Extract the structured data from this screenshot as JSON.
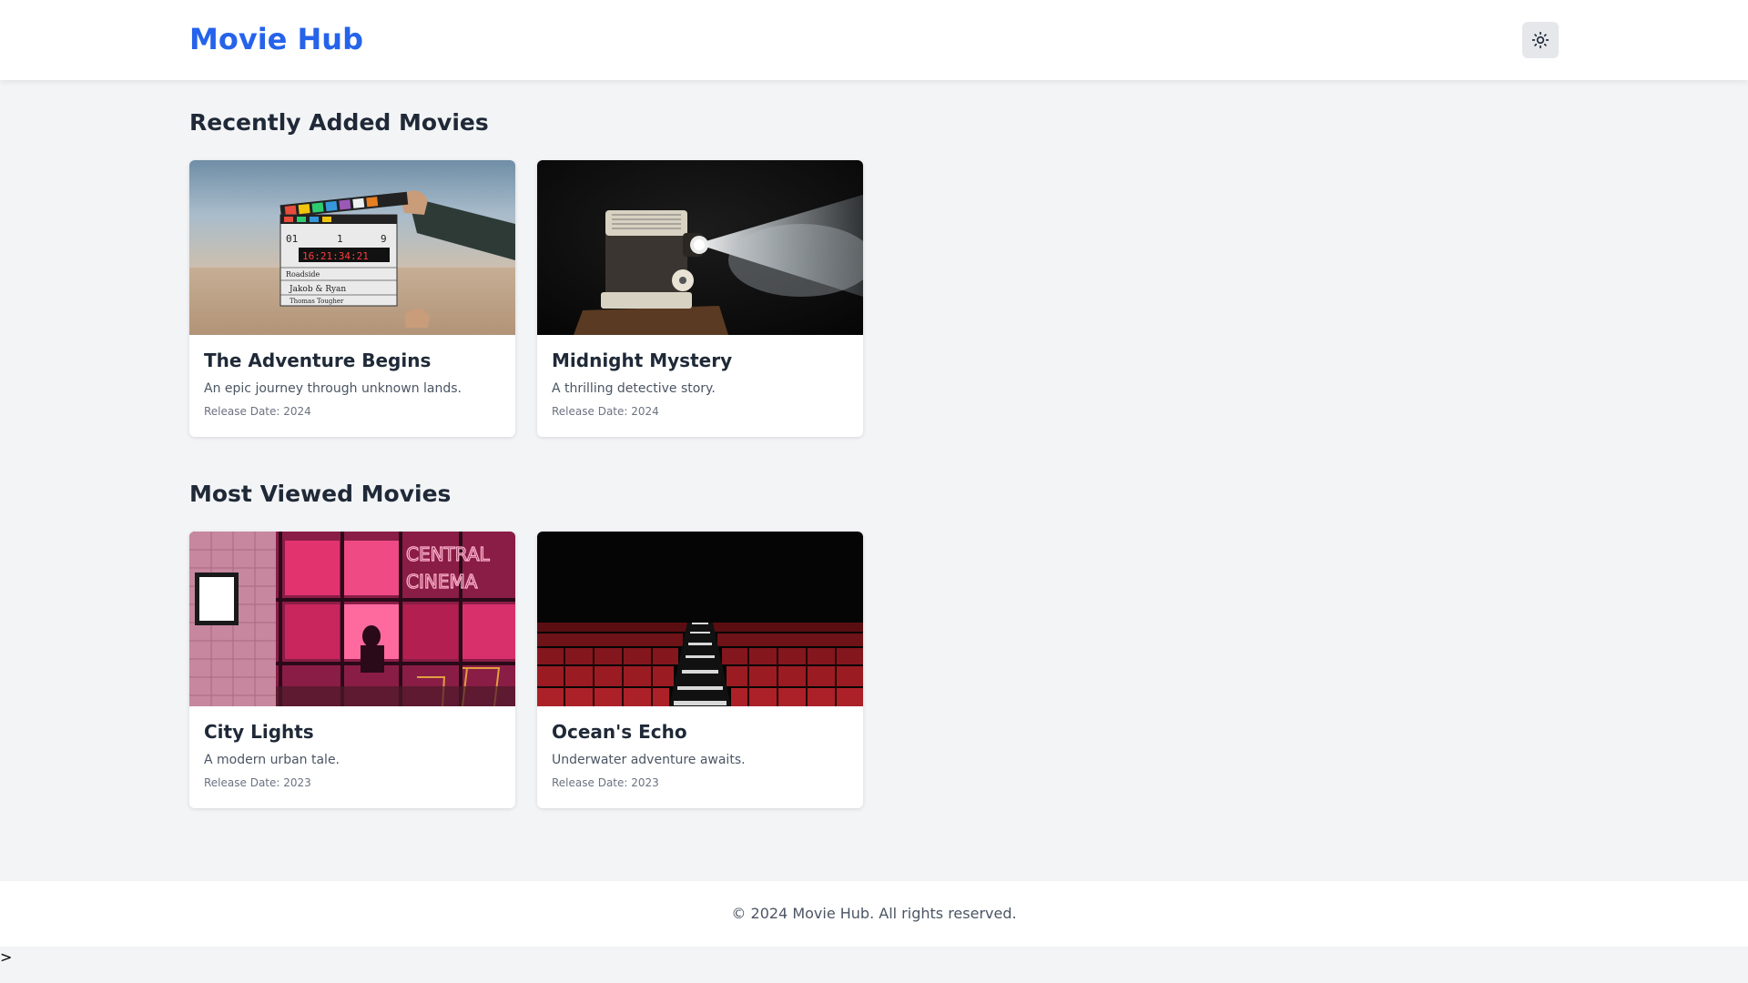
{
  "header": {
    "logo": "Movie Hub",
    "theme_toggle_icon": "sun-icon"
  },
  "sections": [
    {
      "title": "Recently Added Movies",
      "movies": [
        {
          "title": "The Adventure Begins",
          "description": "An epic journey through unknown lands.",
          "release": "Release Date: 2024",
          "image": "clapperboard-desert-photo",
          "clapper": {
            "scene": "01",
            "take": "1",
            "roll": "9",
            "timecode": "16:21:34:21",
            "production": "Roadside",
            "director": "Jakob & Ryan",
            "camera": "Thomas Tougher"
          }
        },
        {
          "title": "Midnight Mystery",
          "description": "A thrilling detective story.",
          "release": "Release Date: 2024",
          "image": "film-projector-photo"
        }
      ]
    },
    {
      "title": "Most Viewed Movies",
      "movies": [
        {
          "title": "City Lights",
          "description": "A modern urban tale.",
          "release": "Release Date: 2023",
          "image": "neon-cinema-storefront-photo",
          "sign": [
            "CENTRAL",
            "CINEMA"
          ]
        },
        {
          "title": "Ocean's Echo",
          "description": "Underwater adventure awaits.",
          "release": "Release Date: 2023",
          "image": "theater-seats-photo"
        }
      ]
    }
  ],
  "footer": {
    "text": "© 2024 Movie Hub. All rights reserved."
  },
  "stray": ">",
  "colors": {
    "accent": "#2563eb",
    "background": "#f3f4f6",
    "card": "#ffffff"
  }
}
